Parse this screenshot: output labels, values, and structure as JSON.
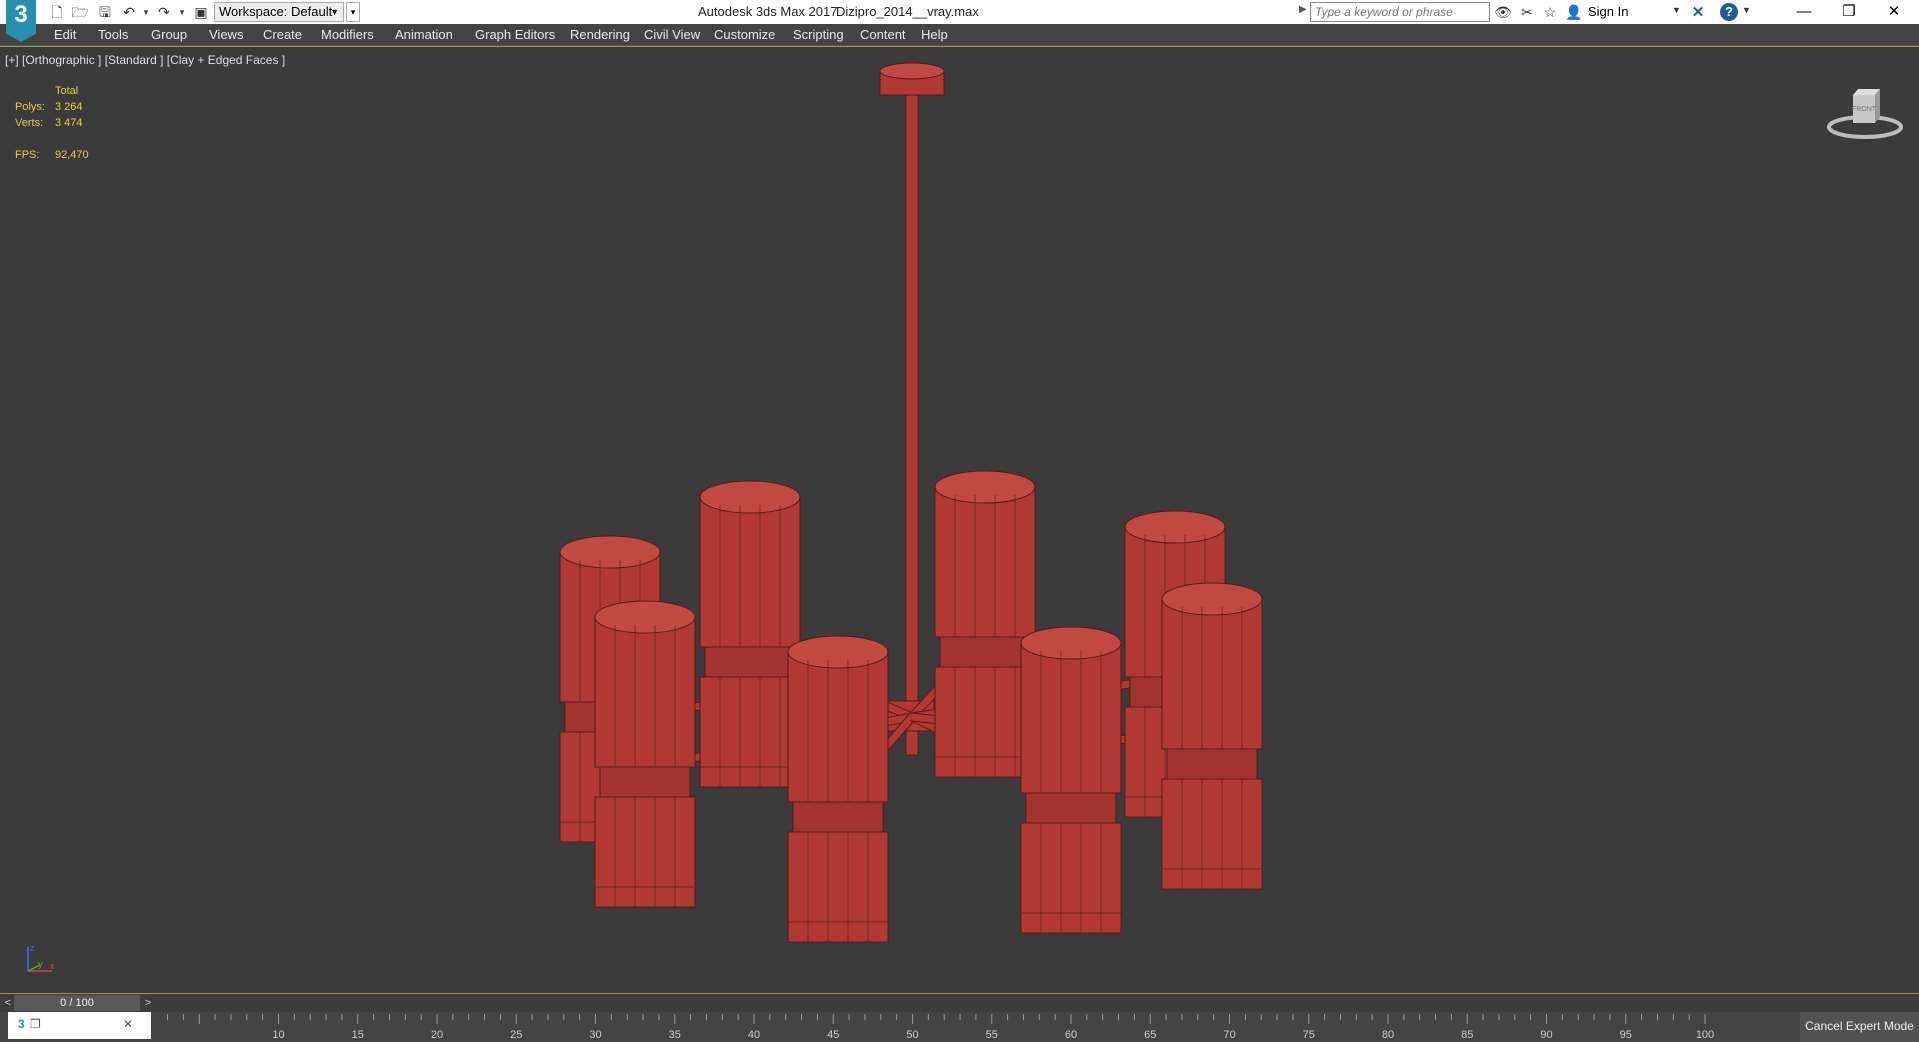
{
  "titlebar": {
    "app_icon": "3",
    "workspace_label": "Workspace: Default",
    "app_title": "Autodesk 3ds Max 2017",
    "file_name": "Dizipro_2014__vray.max",
    "search_placeholder": "Type a keyword or phrase",
    "sign_in": "Sign In",
    "help": "?"
  },
  "menu": [
    "Edit",
    "Tools",
    "Group",
    "Views",
    "Create",
    "Modifiers",
    "Animation",
    "Graph Editors",
    "Rendering",
    "Civil View",
    "Customize",
    "Scripting",
    "Content",
    "Help"
  ],
  "viewport": {
    "label": "[+] [Orthographic ] [Standard ] [Clay + Edged Faces ]",
    "stats": {
      "header": "Total",
      "polys_label": "Polys:",
      "polys_value": "3 264",
      "verts_label": "Verts:",
      "verts_value": "3 474",
      "fps_label": "FPS:",
      "fps_value": "92,470"
    },
    "viewcube_label": "FRONT",
    "axis": {
      "x": "x",
      "y": "y",
      "z": "z"
    },
    "model_color": "#b03a33",
    "accent_color": "#a39344"
  },
  "timeline": {
    "position": "0 / 100",
    "prev": "<",
    "next": ">",
    "ticks": [
      "10",
      "15",
      "20",
      "25",
      "30",
      "35",
      "40",
      "45",
      "50",
      "55",
      "60",
      "65",
      "70",
      "75",
      "80",
      "85",
      "90",
      "95",
      "100"
    ],
    "cancel_expert_mode": "Cancel Expert Mode"
  }
}
